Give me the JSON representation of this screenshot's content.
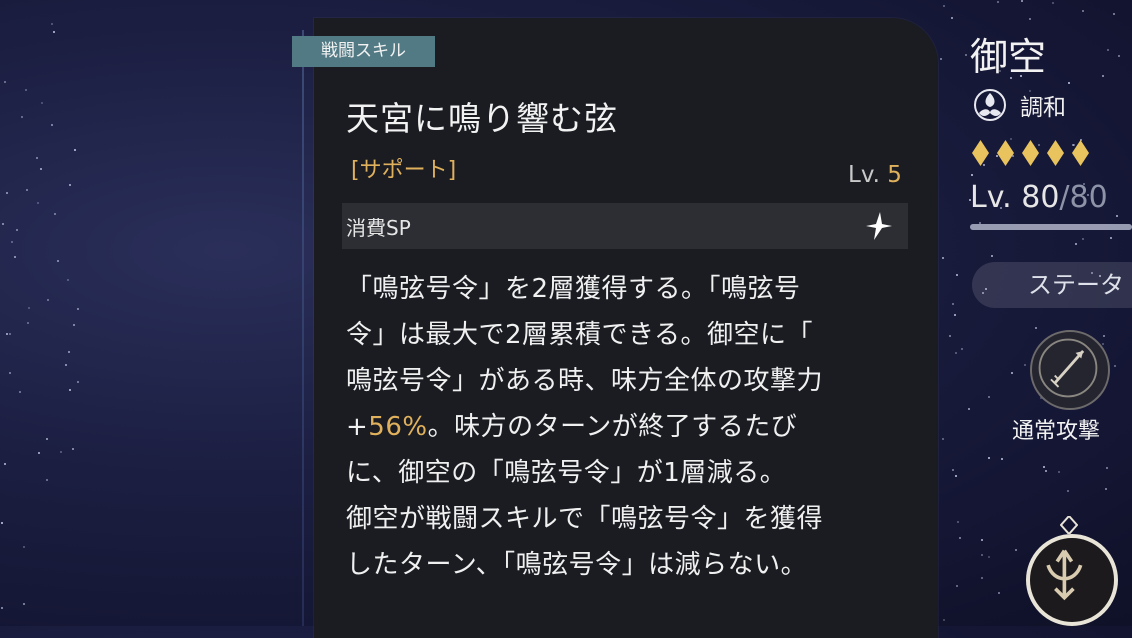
{
  "tooltip": {
    "tag": "戦闘スキル",
    "title": "天宮に鳴り響む弦",
    "category": "[サポート]",
    "level_prefix": "Lv.",
    "level_value": "5",
    "sp_label": "消費SP",
    "sp_icon": "sp-star-icon",
    "description_lines": [
      "「鳴弦号令」を2層獲得する。「鳴弦号",
      "令」は最大で2層累積できる。御空に「",
      "鳴弦号令」がある時、味方全体の攻撃力",
      "+",
      "56%",
      "。味方のターンが終了するたび",
      "に、御空の「鳴弦号令」が1層減る。",
      "御空が戦闘スキルで「鳴弦号令」を獲得",
      "したターン、「鳴弦号令」は減らない。"
    ]
  },
  "character": {
    "name": "御空",
    "path_icon": "harmony-path-icon",
    "path": "調和",
    "rarity_stars": 5,
    "level_prefix": "Lv.",
    "level": "80",
    "level_separator": "/",
    "level_max": "80",
    "level_progress": 1.0,
    "status_button": "ステータ",
    "basic_attack_label": "通常攻撃",
    "basic_attack_icon": "arrow-icon",
    "ultimate_icon": "bow-ultimate-icon"
  },
  "colors": {
    "accent_gold": "#e0b15d",
    "tag_bg": "#527a84",
    "panel_bg": "#1a1c22"
  }
}
